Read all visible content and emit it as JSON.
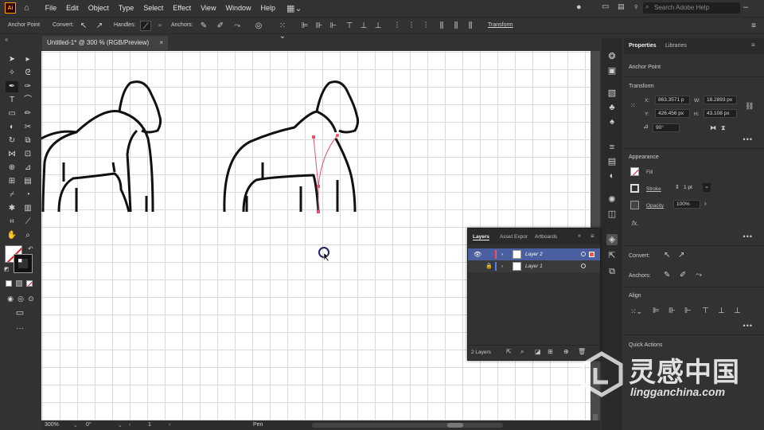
{
  "menubar": {
    "app_logo": "Ai",
    "items": [
      "File",
      "Edit",
      "Object",
      "Type",
      "Select",
      "Effect",
      "View",
      "Window",
      "Help"
    ],
    "search_placeholder": "Search Adobe Help"
  },
  "controlbar": {
    "tool_name": "Anchor Point",
    "convert_label": "Convert:",
    "handles_label": "Handles:",
    "anchors_label": "Anchors:",
    "transform_label": "Transform"
  },
  "document": {
    "tab_title": "Untitled-1* @ 300 % (RGB/Preview)",
    "close_glyph": "×"
  },
  "statusbar": {
    "zoom": "300%",
    "rotation": "0°",
    "artboard": "1",
    "tool": "Pen"
  },
  "properties": {
    "tabs": [
      "Properties",
      "Libraries"
    ],
    "selection_type": "Anchor Point",
    "transform": {
      "heading": "Transform",
      "x_label": "X:",
      "x": "863.3571 p",
      "y_label": "Y:",
      "y": "426.456 px",
      "w_label": "W:",
      "w": "18.2893 px",
      "h_label": "H:",
      "h": "43.108 px",
      "angle": "90°"
    },
    "appearance": {
      "heading": "Appearance",
      "fill_label": "Fill",
      "stroke_label": "Stroke",
      "stroke_weight": "1 pt",
      "opacity_label": "Opacity",
      "opacity": "100%",
      "fx": "fx."
    },
    "convert_label": "Convert:",
    "anchors_label": "Anchors:",
    "align_heading": "Align",
    "quick_actions_heading": "Quick Actions"
  },
  "layers_panel": {
    "tabs": [
      "Layers",
      "Asset Expor",
      "Artboards"
    ],
    "layers": [
      {
        "name": "Layer 2",
        "selected": true,
        "color": "#ff4f4f"
      },
      {
        "name": "Layer 1",
        "selected": false,
        "color": "#4f7fff"
      }
    ],
    "count_label": "2 Layers"
  },
  "watermark": {
    "cn": "灵感中国",
    "url": "lingganchina.com"
  },
  "colors": {
    "accent_blue": "#4a5fa0",
    "path_red": "#e0566b",
    "ai_orange": "#ff9a00"
  }
}
